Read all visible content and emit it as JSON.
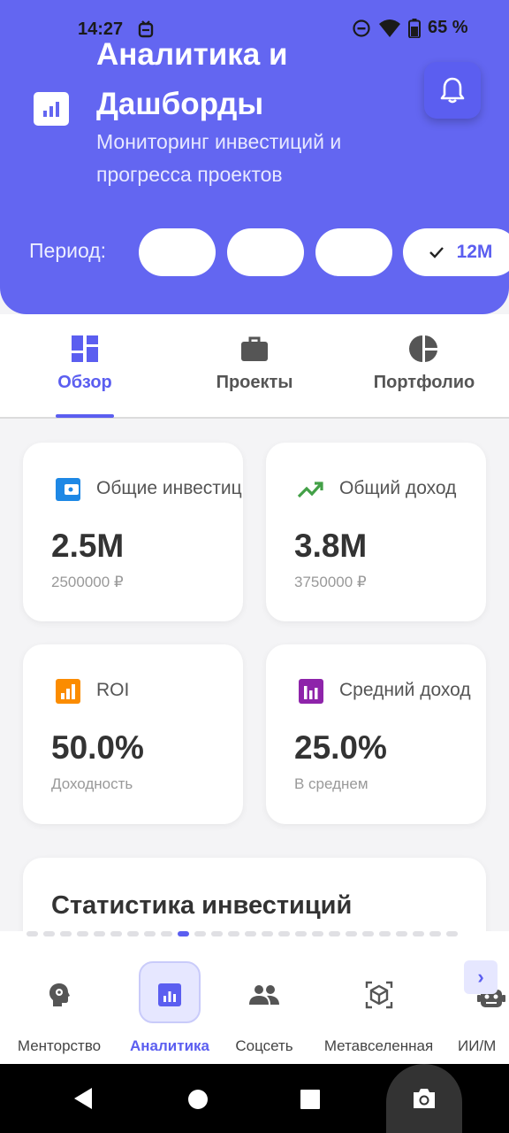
{
  "status_bar": {
    "time": "14:27",
    "battery": "65 %"
  },
  "header": {
    "title": "Аналитика и Дашборды",
    "subtitle": "Мониторинг инвестиций и прогресса проектов",
    "icon": "analytics-icon",
    "bell_icon": "bell-icon",
    "background": "#6366f1"
  },
  "period": {
    "label": "Период:",
    "options": [
      "",
      "",
      "",
      "12M"
    ],
    "selected": "12M"
  },
  "tabs": [
    {
      "label": "Обзор",
      "icon": "dashboard-icon",
      "active": true
    },
    {
      "label": "Проекты",
      "icon": "briefcase-icon",
      "active": false
    },
    {
      "label": "Портфолио",
      "icon": "pie-chart-icon",
      "active": false
    }
  ],
  "cards": [
    {
      "label": "Общие инвестиции",
      "value": "2.5M",
      "sub": "2500000 ₽",
      "icon": "wallet-icon",
      "color": "#1e88e5"
    },
    {
      "label": "Общий доход",
      "value": "3.8M",
      "sub": "3750000 ₽",
      "icon": "trending-up-icon",
      "color": "#43a047"
    },
    {
      "label": "ROI",
      "value": "50.0%",
      "sub": "Доходность",
      "icon": "bar-chart-icon",
      "color": "#fb8c00"
    },
    {
      "label": "Средний доход",
      "value": "25.0%",
      "sub": "В среднем",
      "icon": "insights-icon",
      "color": "#8e24aa"
    }
  ],
  "stats": {
    "title": "Статистика инвестиций"
  },
  "bottom_nav": {
    "items": [
      {
        "label": "Менторство",
        "icon": "mentor-icon",
        "active": false
      },
      {
        "label": "Аналитика",
        "icon": "analytics-icon",
        "active": true
      },
      {
        "label": "Соцсеть",
        "icon": "people-icon",
        "active": false
      },
      {
        "label": "Метавселенная",
        "icon": "cube-icon",
        "active": false
      },
      {
        "label": "ИИ/М",
        "icon": "robot-icon",
        "active": false
      }
    ],
    "scroll_icon": "chevron-right-icon",
    "accent": "#5b5ef0"
  }
}
